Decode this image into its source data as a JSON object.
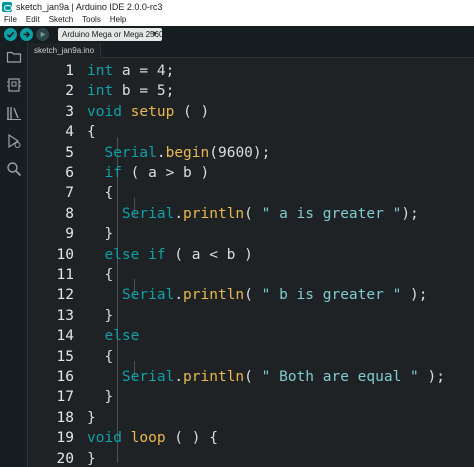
{
  "window": {
    "title": "sketch_jan9a | Arduino IDE 2.0.0-rc3"
  },
  "menu": [
    "File",
    "Edit",
    "Sketch",
    "Tools",
    "Help"
  ],
  "toolbar": {
    "verify_icon": "check-icon",
    "upload_icon": "arrow-right-icon",
    "board_selected": "Arduino Mega or Mega 2560 ..."
  },
  "sidebar": {
    "items": [
      "folder-icon",
      "board-icon",
      "library-icon",
      "debug-icon",
      "search-icon"
    ]
  },
  "tab": {
    "label": "sketch_jan9a.ino"
  },
  "colors": {
    "accent": "#0ca1a6",
    "function": "#e8b94a",
    "background": "#1f2225",
    "chrome": "#171e21"
  },
  "editor": {
    "line_numbers": [
      "1",
      "2",
      "3",
      "4",
      "5",
      "6",
      "7",
      "8",
      "9",
      "10",
      "11",
      "12",
      "13",
      "14",
      "15",
      "16",
      "17",
      "18",
      "19",
      "20"
    ],
    "lines": [
      [
        {
          "t": "int",
          "c": "kw"
        },
        {
          "t": " a = 4;",
          "c": "p"
        }
      ],
      [
        {
          "t": "int",
          "c": "kw"
        },
        {
          "t": " b = 5;",
          "c": "p"
        }
      ],
      [
        {
          "t": "void",
          "c": "kw"
        },
        {
          "t": " ",
          "c": "p"
        },
        {
          "t": "setup",
          "c": "fn"
        },
        {
          "t": " ( )",
          "c": "p"
        }
      ],
      [
        {
          "t": "{",
          "c": "p"
        }
      ],
      [
        {
          "t": "  ",
          "c": "p"
        },
        {
          "t": "Serial",
          "c": "obj"
        },
        {
          "t": ".",
          "c": "p"
        },
        {
          "t": "begin",
          "c": "fn"
        },
        {
          "t": "(9600);",
          "c": "p"
        }
      ],
      [
        {
          "t": "  ",
          "c": "p"
        },
        {
          "t": "if",
          "c": "kw"
        },
        {
          "t": " ( a > b )",
          "c": "p"
        }
      ],
      [
        {
          "t": "  {",
          "c": "p"
        }
      ],
      [
        {
          "t": "    ",
          "c": "p"
        },
        {
          "t": "Serial",
          "c": "obj"
        },
        {
          "t": ".",
          "c": "p"
        },
        {
          "t": "println",
          "c": "fn"
        },
        {
          "t": "( ",
          "c": "p"
        },
        {
          "t": "\" a is greater \"",
          "c": "str"
        },
        {
          "t": ");",
          "c": "p"
        }
      ],
      [
        {
          "t": "  }",
          "c": "p"
        }
      ],
      [
        {
          "t": "  ",
          "c": "p"
        },
        {
          "t": "else if",
          "c": "kw"
        },
        {
          "t": " ( a < b )",
          "c": "p"
        }
      ],
      [
        {
          "t": "  {",
          "c": "p"
        }
      ],
      [
        {
          "t": "    ",
          "c": "p"
        },
        {
          "t": "Serial",
          "c": "obj"
        },
        {
          "t": ".",
          "c": "p"
        },
        {
          "t": "println",
          "c": "fn"
        },
        {
          "t": "( ",
          "c": "p"
        },
        {
          "t": "\" b is greater \"",
          "c": "str"
        },
        {
          "t": " );",
          "c": "p"
        }
      ],
      [
        {
          "t": "  }",
          "c": "p"
        }
      ],
      [
        {
          "t": "  ",
          "c": "p"
        },
        {
          "t": "else",
          "c": "kw"
        }
      ],
      [
        {
          "t": "  {",
          "c": "p"
        }
      ],
      [
        {
          "t": "    ",
          "c": "p"
        },
        {
          "t": "Serial",
          "c": "obj"
        },
        {
          "t": ".",
          "c": "p"
        },
        {
          "t": "println",
          "c": "fn"
        },
        {
          "t": "( ",
          "c": "p"
        },
        {
          "t": "\" Both are equal \"",
          "c": "str"
        },
        {
          "t": " );",
          "c": "p"
        }
      ],
      [
        {
          "t": "  }",
          "c": "p"
        }
      ],
      [
        {
          "t": "}",
          "c": "p"
        }
      ],
      [
        {
          "t": "void",
          "c": "kw"
        },
        {
          "t": " ",
          "c": "p"
        },
        {
          "t": "loop",
          "c": "fn"
        },
        {
          "t": " ( ) {",
          "c": "p"
        }
      ],
      [
        {
          "t": "}",
          "c": "p"
        }
      ]
    ]
  }
}
